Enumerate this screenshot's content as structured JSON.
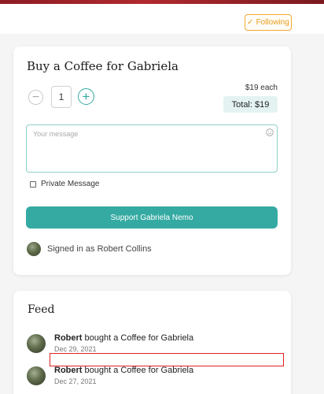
{
  "header": {
    "follow_label": "Following",
    "follow_icon": "check-icon"
  },
  "buy": {
    "title": "Buy a Coffee for Gabriela",
    "quantity": "1",
    "price_each": "$19 each",
    "total": "Total: $19",
    "message_placeholder": "Your message",
    "private_label": "Private Message",
    "support_label": "Support Gabriela Nemo",
    "signed_in": "Signed in as Robert Collins"
  },
  "feed": {
    "title": "Feed",
    "items": [
      {
        "name": "Robert",
        "action": " bought a Coffee for Gabriela",
        "date": "Dec 29, 2021"
      },
      {
        "name": "Robert",
        "action": " bought a Coffee for Gabriela",
        "date": "Dec 27, 2021"
      }
    ]
  },
  "colors": {
    "accent": "#35aaa3",
    "follow": "#e89a1e",
    "highlight": "#e02020"
  }
}
